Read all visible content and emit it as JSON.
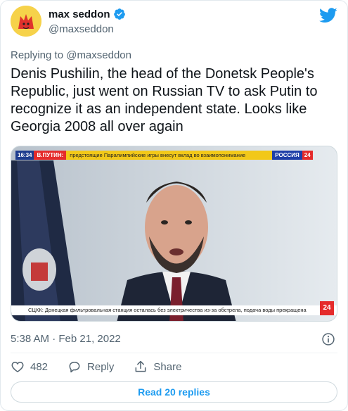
{
  "author": {
    "name": "max seddon",
    "handle": "@maxseddon",
    "verified": true,
    "avatar_icon": "fox-avatar-icon"
  },
  "platform_icon": "twitter-bird-icon",
  "replying_to": "Replying to @maxseddon",
  "tweet_text": "Denis Pushilin, the head of the Donetsk People's Republic, just went on Russian TV to ask Putin to recognize it as an independent state. Looks like Georgia 2008 all over again",
  "media": {
    "ticker_time": "16:34",
    "ticker_name": "В.ПУТИН:",
    "ticker_text": "предстоящие Паралимпийские игры внесут вклад во взаимопонимание",
    "channel": "РОССИЯ",
    "channel_number": "24",
    "bottom_ticker": "СЦКК: Донецкая фильтровальная станция осталась без электричества из-за обстрела, подача воды прекращена"
  },
  "timestamp": "5:38 AM · Feb 21, 2022",
  "info_icon": "info-icon",
  "actions": {
    "like_count": "482",
    "reply_label": "Reply",
    "share_label": "Share"
  },
  "read_replies_label": "Read 20 replies",
  "colors": {
    "accent": "#1d9bf0",
    "text_primary": "#0f1419",
    "text_secondary": "#536471",
    "border": "#cfd9de"
  }
}
